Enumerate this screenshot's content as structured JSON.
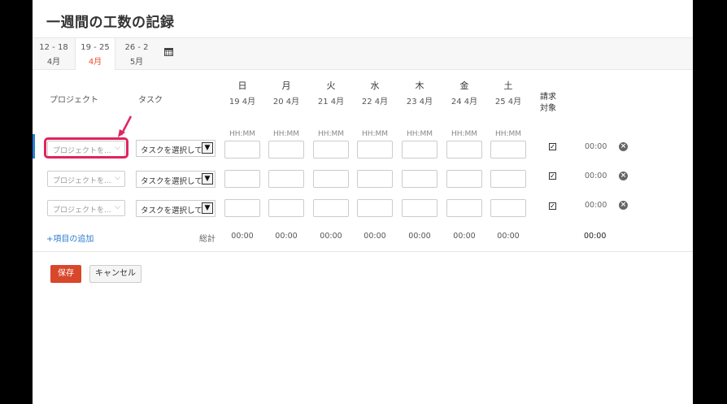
{
  "page_title": "一週間の工数の記録",
  "weeks": [
    {
      "range": "12 - 18",
      "month": "4月",
      "active": false
    },
    {
      "range": "19 - 25",
      "month": "4月",
      "active": true
    },
    {
      "range": "26 - 2",
      "month": "5月",
      "active": false
    }
  ],
  "icons": {
    "calendar": "calendar-icon",
    "delete": "close-circle-icon",
    "add": "plus-icon",
    "annotation": "arrow-icon"
  },
  "columns": {
    "project": "プロジェクト",
    "task": "タスク",
    "billable": "請求対象"
  },
  "days": [
    {
      "name": "日",
      "date": "19 4月"
    },
    {
      "name": "月",
      "date": "20 4月"
    },
    {
      "name": "火",
      "date": "21 4月"
    },
    {
      "name": "水",
      "date": "22 4月"
    },
    {
      "name": "木",
      "date": "23 4月"
    },
    {
      "name": "金",
      "date": "24 4月"
    },
    {
      "name": "土",
      "date": "25 4月"
    }
  ],
  "time_placeholder": "HH:MM",
  "rows": [
    {
      "project_placeholder": "プロジェクトを...",
      "task_placeholder": "タスクを選択して",
      "billable": true,
      "total": "00:00"
    },
    {
      "project_placeholder": "プロジェクトを...",
      "task_placeholder": "タスクを選択して",
      "billable": true,
      "total": "00:00"
    },
    {
      "project_placeholder": "プロジェクトを...",
      "task_placeholder": "タスクを選択して",
      "billable": true,
      "total": "00:00"
    }
  ],
  "add_item_label": "+項目の追加",
  "total_label": "総計",
  "day_totals": [
    "00:00",
    "00:00",
    "00:00",
    "00:00",
    "00:00",
    "00:00",
    "00:00"
  ],
  "grand_total": "00:00",
  "buttons": {
    "save": "保存",
    "cancel": "キャンセル"
  },
  "colors": {
    "accent": "#e8502a",
    "save": "#d9472b",
    "link": "#2b7bd0",
    "highlight": "#e0245e"
  }
}
